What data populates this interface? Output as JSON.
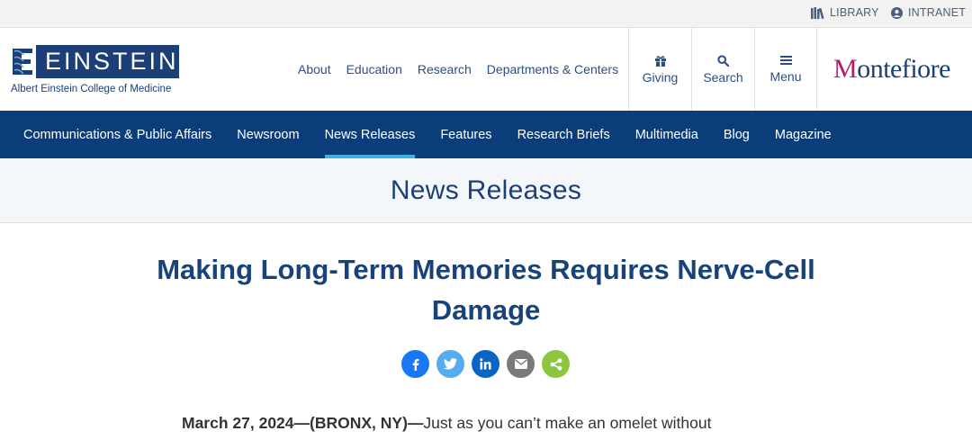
{
  "utility_bar": {
    "library_label": "LIBRARY",
    "intranet_label": "INTRANET"
  },
  "header": {
    "logo_word": "EINSTEIN",
    "logo_subtitle": "Albert Einstein College of Medicine",
    "main_nav": [
      "About",
      "Education",
      "Research",
      "Departments & Centers"
    ],
    "giving_label": "Giving",
    "search_label": "Search",
    "menu_label": "Menu",
    "partner_logo_first": "M",
    "partner_logo_rest": "ontefiore"
  },
  "section_nav": {
    "items": [
      "Communications & Public Affairs",
      "Newsroom",
      "News Releases",
      "Features",
      "Research Briefs",
      "Multimedia",
      "Blog",
      "Magazine"
    ],
    "active": "News Releases"
  },
  "page_title": "News Releases",
  "article": {
    "title": "Making Long-Term Memories Requires Nerve-Cell Damage",
    "dateline": "March 27, 2024—(BRONX, NY)—",
    "lede_start": "Just as you can’t make an omelet without"
  },
  "share_icons": [
    "facebook-icon",
    "twitter-icon",
    "linkedin-icon",
    "email-icon",
    "share-icon"
  ],
  "colors": {
    "brand_navy": "#0b3d7a",
    "active_underline": "#3db0e8",
    "montefiore_accent": "#b01c6e"
  }
}
